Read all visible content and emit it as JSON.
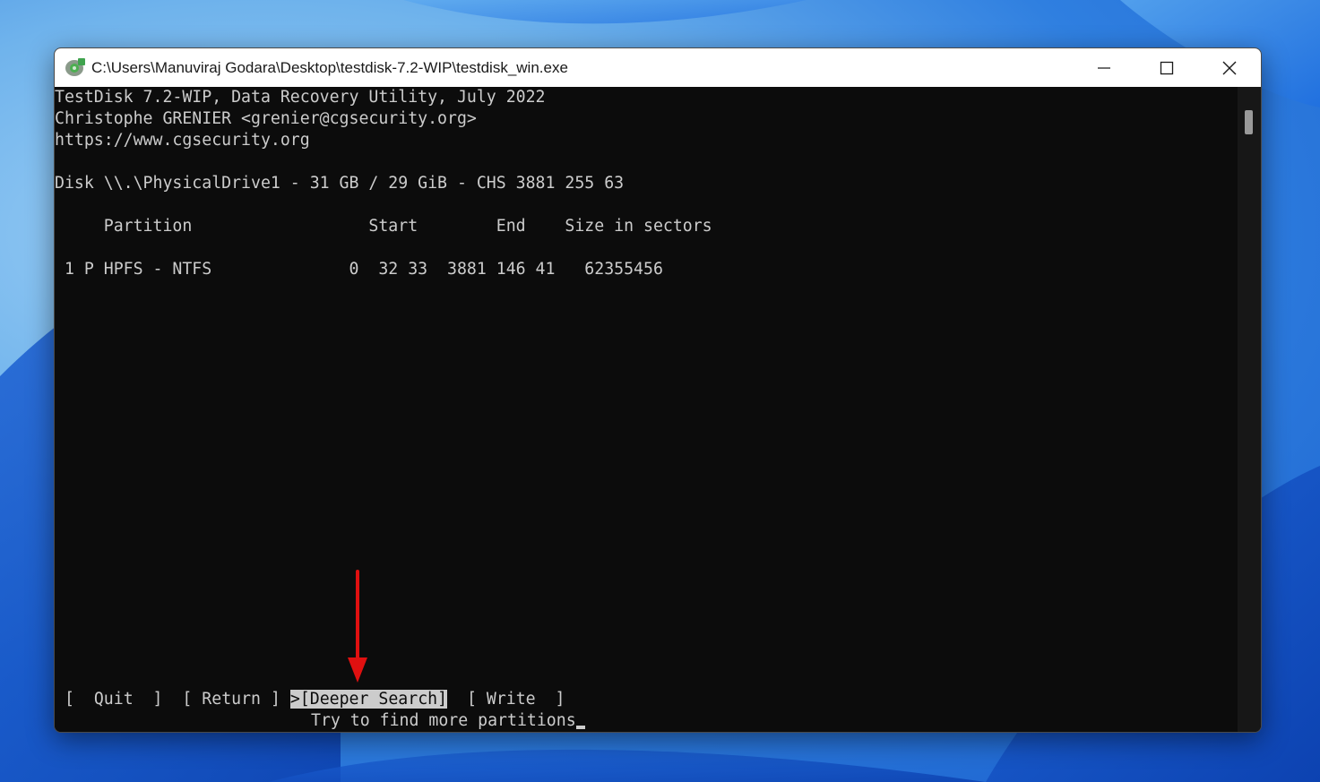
{
  "window": {
    "title": "C:\\Users\\Manuviraj Godara\\Desktop\\testdisk-7.2-WIP\\testdisk_win.exe"
  },
  "terminal": {
    "header_line1": "TestDisk 7.2-WIP, Data Recovery Utility, July 2022",
    "header_line2": "Christophe GRENIER <grenier@cgsecurity.org>",
    "header_line3": "https://www.cgsecurity.org",
    "disk_line": "Disk \\\\.\\PhysicalDrive1 - 31 GB / 29 GiB - CHS 3881 255 63",
    "table_header": "     Partition                  Start        End    Size in sectors",
    "partition_row": " 1 P HPFS - NTFS              0  32 33  3881 146 41   62355456",
    "menu": {
      "quit": "[  Quit  ]",
      "return": "[ Return ]",
      "deeper_search": ">[Deeper Search]",
      "write": "[ Write  ]"
    },
    "hint": "Try to find more partitions"
  },
  "colors": {
    "terminal_bg": "#0c0c0c",
    "terminal_fg": "#cccccc",
    "annotation_arrow": "#e01010"
  },
  "icons": {
    "app": "testdisk-app-icon",
    "minimize": "minimize-icon",
    "maximize": "maximize-icon",
    "close": "close-icon",
    "annotation": "red-arrow-icon"
  }
}
